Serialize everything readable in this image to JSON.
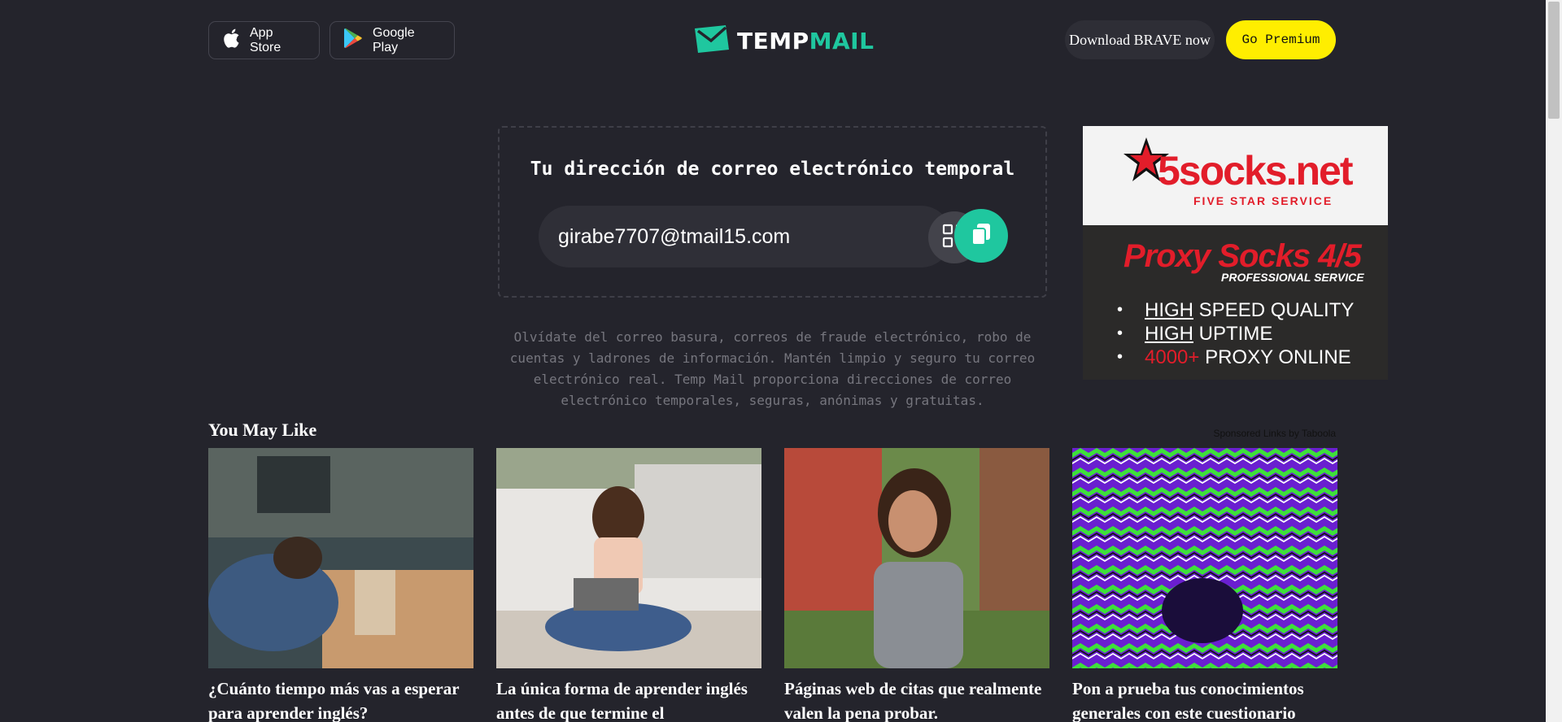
{
  "header": {
    "app_store_label": "App Store",
    "google_play_label": "Google Play",
    "logo_temp": "TEMP",
    "logo_mail": "MAIL",
    "brave_label": "Download BRAVE now",
    "premium_label": "Go Premium"
  },
  "email": {
    "title": "Tu dirección de correo electrónico temporal",
    "address": "girabe7707@tmail15.com"
  },
  "description": "Olvídate del correo basura, correos de fraude electrónico, robo de cuentas y ladrones de información. Mantén limpio y seguro tu correo electrónico real. Temp Mail proporciona direcciones de correo electrónico temporales, seguras, anónimas y gratuitas.",
  "ad": {
    "brand": "5socks.net",
    "tagline": "FIVE STAR SERVICE",
    "headline": "Proxy Socks 4/5",
    "subheadline": "PROFESSIONAL SERVICE",
    "items": [
      {
        "emph": "HIGH",
        "rest": " SPEED QUALITY"
      },
      {
        "emph": "HIGH",
        "rest": " UPTIME"
      },
      {
        "emph": "4000+",
        "rest": " PROXY ONLINE"
      }
    ]
  },
  "recommendations": {
    "heading": "You May Like",
    "sponsored": "Sponsored Links by Taboola",
    "cards": [
      {
        "title": "¿Cuánto tiempo más vas a esperar para aprender inglés?"
      },
      {
        "title": "La única forma de aprender inglés antes de que termine el"
      },
      {
        "title": "Páginas web de citas que realmente valen la pena probar."
      },
      {
        "title": "Pon a prueba tus conocimientos generales con este cuestionario"
      }
    ]
  },
  "colors": {
    "background": "#24242c",
    "accent": "#1fc79f",
    "premium": "#ffee00",
    "ad_red": "#e21d2a"
  }
}
